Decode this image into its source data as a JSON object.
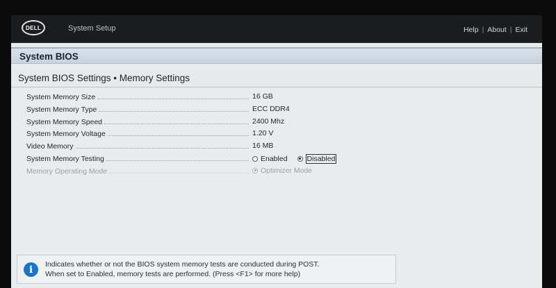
{
  "topbar": {
    "logo_text": "DELL",
    "app_title": "System Setup",
    "links": [
      "Help",
      "About",
      "Exit"
    ],
    "separator": "|"
  },
  "bios_header": "System BIOS",
  "section_title": "System BIOS Settings • Memory Settings",
  "settings": [
    {
      "label": "System Memory Size",
      "value": "16 GB"
    },
    {
      "label": "System Memory Type",
      "value": "ECC DDR4"
    },
    {
      "label": "System Memory Speed",
      "value": "2400 Mhz"
    },
    {
      "label": "System Memory Voltage",
      "value": "1.20 V"
    },
    {
      "label": "Video Memory",
      "value": "16 MB"
    },
    {
      "label": "System Memory Testing",
      "options": [
        {
          "label": "Enabled",
          "selected": false
        },
        {
          "label": "Disabled",
          "selected": true
        }
      ]
    },
    {
      "label": "Memory Operating Mode",
      "options": [
        {
          "label": "Optimizer Mode",
          "selected": true
        }
      ],
      "disabled": true
    }
  ],
  "help": {
    "icon": "info-icon",
    "line1": "Indicates whether or not the BIOS system memory tests are conducted during POST.",
    "line2": "When set to Enabled, memory tests are performed. (Press <F1> for more help)"
  },
  "colors": {
    "topbar_bg": "#1b1c1e",
    "panel_bg": "#e9ecec",
    "info_blue": "#1b74c7"
  }
}
